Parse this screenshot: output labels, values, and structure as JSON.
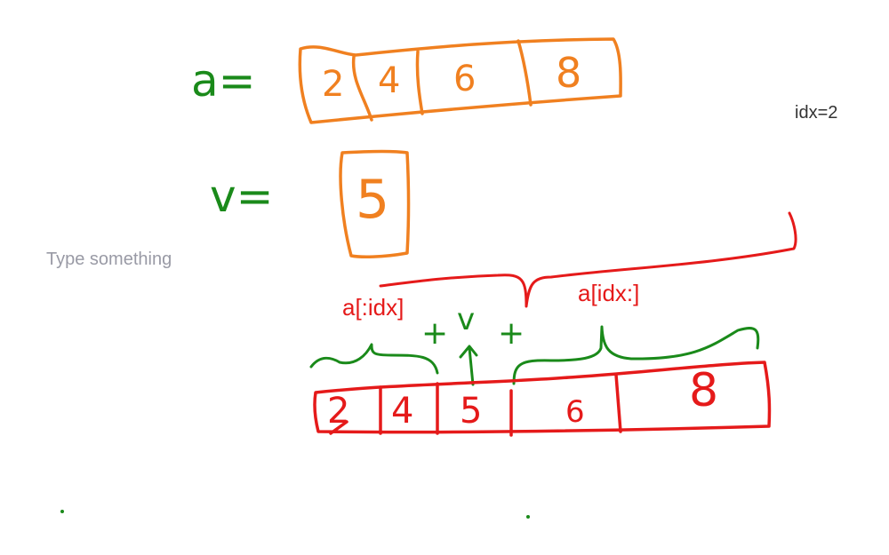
{
  "board": {
    "idx_label": "idx=2",
    "text_input_placeholder": "Type something",
    "left_slice_label": "a[:idx]",
    "right_slice_label": "a[idx:]"
  },
  "handwriting": {
    "a_eq": "a=",
    "v_eq": "v=",
    "array_a": [
      "2",
      "4",
      "6",
      "8"
    ],
    "value_v": "5",
    "plus_v_plus": [
      "+",
      "v",
      "+"
    ],
    "result_array": [
      "2",
      "4",
      "5",
      "6",
      "8"
    ]
  },
  "colors": {
    "green": "#1a8a1a",
    "orange": "#f08020",
    "red": "#e51a1a",
    "text": "#333333",
    "placeholder": "#999aa5"
  }
}
